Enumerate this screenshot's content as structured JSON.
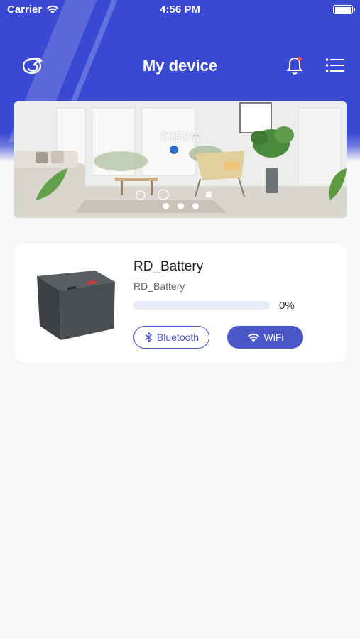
{
  "status_bar": {
    "carrier": "Carrier",
    "time": "4:56 PM"
  },
  "nav": {
    "title": "My device",
    "notification_badge_color": "#ff4d4f",
    "icons": [
      "brand-logo-icon",
      "bell-icon",
      "menu-list-icon"
    ]
  },
  "banner": {
    "label": "智能家居",
    "page_count": 3
  },
  "device": {
    "name": "RD_Battery",
    "subtitle": "RD_Battery",
    "progress_percent": 0,
    "progress_text": "0%",
    "bluetooth_label": "Bluetooth",
    "wifi_label": "WiFi"
  },
  "colors": {
    "primary": "#3a49d4",
    "button": "#4a56c8",
    "background": "#f7f7f7"
  }
}
